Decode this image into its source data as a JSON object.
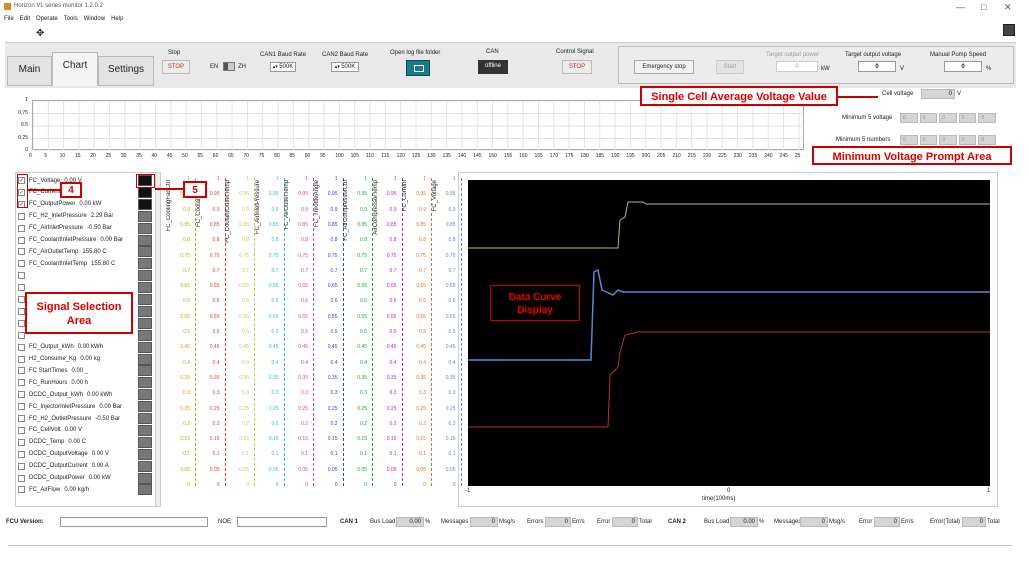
{
  "window": {
    "title": "Horizon VL series monitor 1.2.0.2",
    "min": "—",
    "max": "□",
    "close": "✕"
  },
  "menu": [
    "File",
    "Edit",
    "Operate",
    "Tools",
    "Window",
    "Help"
  ],
  "tabs": [
    "Main",
    "Chart",
    "Settings"
  ],
  "controls": {
    "stop_label": "Stop",
    "stop_btn": "STOP",
    "en_label": "EN",
    "zh_label": "ZH",
    "can1_label": "CAN1 Baud Rate",
    "can1_value": "500K",
    "can2_label": "CAN2 Baud Rate",
    "can2_value": "500K",
    "log_label": "Open log file folder",
    "can_label": "CAN",
    "can_btn": "offline",
    "control_signal_label": "Control Signal",
    "control_signal_btn": "STOP",
    "emergency_btn": "Emergency stop",
    "start_btn": "Start",
    "target_power_label": "Target output power",
    "target_power_value": "0",
    "target_power_unit": "kW",
    "target_voltage_label": "Target output voltage",
    "target_voltage_value": "0",
    "target_voltage_unit": "V",
    "pump_label": "Manual Pump Speed",
    "pump_value": "0",
    "pump_unit": "%"
  },
  "cell_voltage": {
    "label": "Cell voltage",
    "value": "0",
    "unit": "V",
    "min5_label": "Minimum 5 voltage",
    "min5_values": [
      "0",
      "0",
      "0",
      "0",
      "0"
    ],
    "min5num_label": "Minimum 5 numbers",
    "min5num_values": [
      "0",
      "0",
      "0",
      "0",
      "0"
    ]
  },
  "top_chart": {
    "y_ticks": [
      "1",
      "0.75",
      "0.5",
      "0.25",
      "0"
    ],
    "x_ticks": [
      "0",
      "5",
      "10",
      "15",
      "20",
      "25",
      "30",
      "35",
      "40",
      "45",
      "50",
      "55",
      "60",
      "65",
      "70",
      "75",
      "80",
      "85",
      "90",
      "95",
      "100",
      "105",
      "110",
      "115",
      "120",
      "125",
      "130",
      "135",
      "140",
      "145",
      "150",
      "155",
      "160",
      "165",
      "170",
      "175",
      "180",
      "185",
      "190",
      "195",
      "200",
      "205",
      "210",
      "215",
      "220",
      "225",
      "230",
      "235",
      "240",
      "245",
      "25"
    ]
  },
  "signals": [
    {
      "name": "FC_Voltage",
      "value": "0.00 V",
      "checked": true
    },
    {
      "name": "FC_Current",
      "value": "0.00 A",
      "checked": true
    },
    {
      "name": "FC_OutputPower",
      "value": "0.00 kW",
      "checked": true
    },
    {
      "name": "FC_H2_InletPressure",
      "value": "2.29 Bar",
      "checked": false
    },
    {
      "name": "FC_AirInletPressure",
      "value": "-0.50 Bar",
      "checked": false
    },
    {
      "name": "FC_CoolantInletPressure",
      "value": "0.00 Bar",
      "checked": false
    },
    {
      "name": "FC_AirOutletTemp",
      "value": "155.80 C",
      "checked": false
    },
    {
      "name": "FC_CoolantInletTemp",
      "value": "155.80 C",
      "checked": false
    },
    {
      "name": "",
      "value": "",
      "checked": false
    },
    {
      "name": "",
      "value": "",
      "checked": false
    },
    {
      "name": "",
      "value": "",
      "checked": false
    },
    {
      "name": "",
      "value": "",
      "checked": false
    },
    {
      "name": "",
      "value": "",
      "checked": false
    },
    {
      "name": "",
      "value": "",
      "checked": false
    },
    {
      "name": "FC_Output_kWh",
      "value": "0.00 kWh",
      "checked": false
    },
    {
      "name": "H2_Consume_Kg",
      "value": "0.00 kg",
      "checked": false
    },
    {
      "name": "FC StartTimes",
      "value": "0.00 _",
      "checked": false
    },
    {
      "name": "FC_RunHours",
      "value": "0.00 h",
      "checked": false
    },
    {
      "name": "DCDC_Output_kWh",
      "value": "0.00 kWh",
      "checked": false
    },
    {
      "name": "FC_InjectorInletPressure",
      "value": "0.00 Bar",
      "checked": false
    },
    {
      "name": "FC_H2_OutletPressure",
      "value": "-0.50 Bar",
      "checked": false
    },
    {
      "name": "FC_CellVolt",
      "value": "0.00 V",
      "checked": false
    },
    {
      "name": "DCDC_Temp",
      "value": "0.00 C",
      "checked": false
    },
    {
      "name": "DCDC_OutputVoltage",
      "value": "0.00 V",
      "checked": false
    },
    {
      "name": "DCDC_OutputCurrent",
      "value": "0.00 A",
      "checked": false
    },
    {
      "name": "DCDC_OutputPower",
      "value": "0.00 kW",
      "checked": false
    },
    {
      "name": "FC_AirFlow",
      "value": "0.00 kg/h",
      "checked": false
    }
  ],
  "axes": [
    {
      "name": "FC_CoolingFanCtrl",
      "color": "#d4a017"
    },
    {
      "name": "FC_CoolantInletT",
      "color": "#e04040"
    },
    {
      "name": "FC_CoolantOutletTemp",
      "color": "#c8c850"
    },
    {
      "name": "FC_AirInletPressure",
      "color": "#30c0d0"
    },
    {
      "name": "FC_AirOutletTemp",
      "color": "#e040a0"
    },
    {
      "name": "FC_ThrottleAngle",
      "color": "#3040e0"
    },
    {
      "name": "FC_AirCompressorCtrl",
      "color": "#20a040"
    },
    {
      "name": "AirCompressorTemp",
      "color": "#c020c0"
    },
    {
      "name": "FC_Current",
      "color": "#e07020"
    },
    {
      "name": "FC_Voltage",
      "color": "#7080c0"
    }
  ],
  "axis_ticks": [
    "1",
    "0.95",
    "0.9",
    "0.85",
    "0.8",
    "0.75",
    "0.7",
    "0.65",
    "0.6",
    "0.55",
    "0.5",
    "0.45",
    "0.4",
    "0.35",
    "0.3",
    "0.25",
    "0.2",
    "0.15",
    "0.1",
    "0.05",
    "0"
  ],
  "plot": {
    "x_left": "-1",
    "x_mid": "0",
    "x_right": "1",
    "x_label": "time(100ms)"
  },
  "annotations": {
    "a4": "4",
    "a5": "5",
    "signal_area": "Signal Selection Area",
    "data_curve": "Data Curve Display",
    "single_cell": "Single Cell Average Voltage Value",
    "min_voltage": "Minimum Voltage Prompt Area"
  },
  "status": {
    "fcu_label": "FCU Version:",
    "noe_label": "NOE:",
    "can1": "CAN 1",
    "can2": "CAN 2",
    "busload_label": "Bus Load",
    "busload1": "0.00",
    "busload2": "0.00",
    "pct": "%",
    "messages_label": "Messages",
    "msg1": "0",
    "msg2": "0",
    "msgunit": "Msg/s",
    "errors_label": "Errors",
    "err1": "0",
    "errunit": "Err/s",
    "error_label": "Error",
    "total1": "0",
    "total_label": "Total",
    "error2": "0",
    "errtotal_label": "Error(Total)",
    "errtotal2": "0"
  },
  "colors": {
    "accent_red": "#cc0000",
    "plot_bg": "#000000"
  }
}
